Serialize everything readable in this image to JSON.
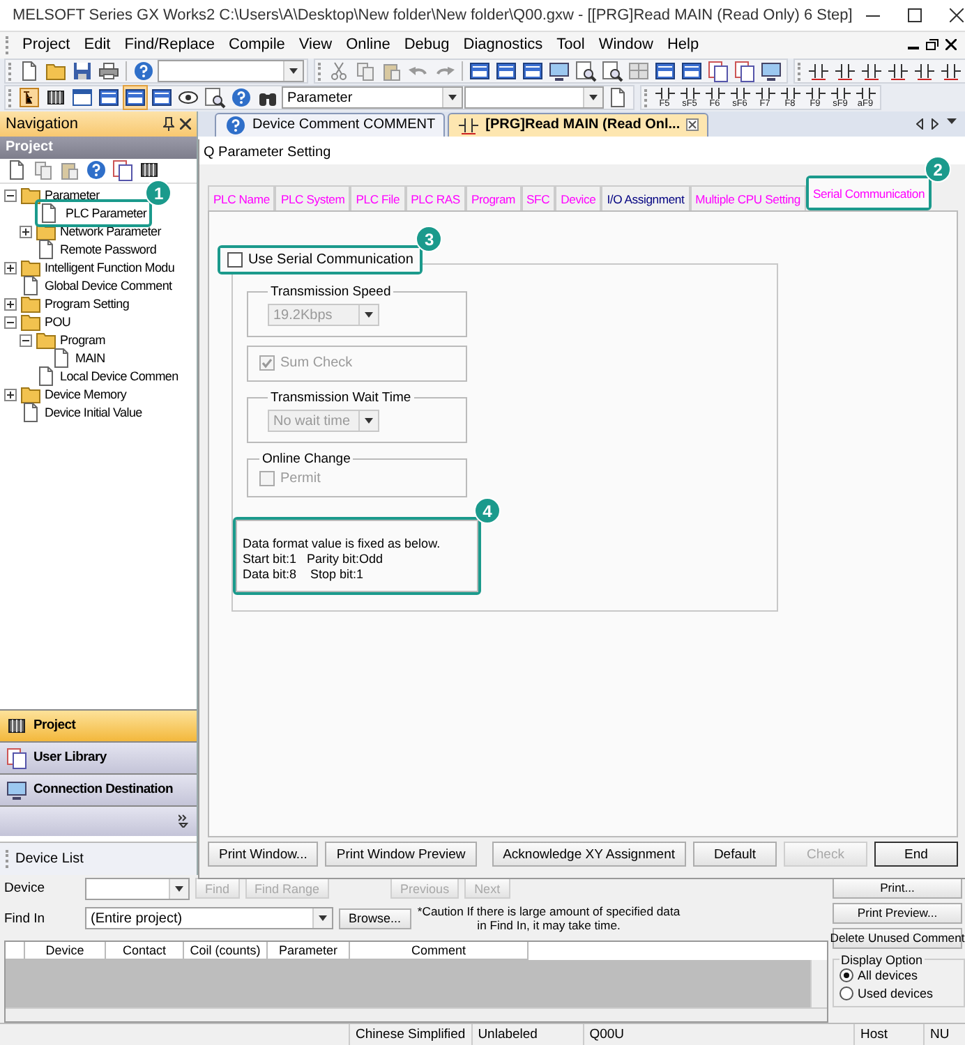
{
  "window": {
    "title": "MELSOFT Series GX Works2 C:\\Users\\A\\Desktop\\New folder\\New folder\\Q00.gxw - [[PRG]Read MAIN (Read Only) 6 Step]"
  },
  "menu": [
    "Project",
    "Edit",
    "Find/Replace",
    "Compile",
    "View",
    "Online",
    "Debug",
    "Diagnostics",
    "Tool",
    "Window",
    "Help"
  ],
  "toolbar": {
    "search_combo": "Parameter",
    "function_keys": [
      "F5",
      "sF5",
      "F6",
      "sF6",
      "F7",
      "F8",
      "F9",
      "sF9",
      "aF9"
    ]
  },
  "navigation": {
    "title": "Navigation",
    "section": "Project",
    "tree": [
      {
        "label": "Parameter",
        "expanded": true,
        "children": [
          {
            "label": "PLC Parameter",
            "callout": "1"
          },
          {
            "label": "Network Parameter",
            "expanded": false
          },
          {
            "label": "Remote Password"
          }
        ]
      },
      {
        "label": "Intelligent Function Modu",
        "expanded": false
      },
      {
        "label": "Global Device Comment"
      },
      {
        "label": "Program Setting",
        "expanded": false
      },
      {
        "label": "POU",
        "expanded": true,
        "children": [
          {
            "label": "Program",
            "expanded": true,
            "children": [
              {
                "label": "MAIN"
              }
            ]
          },
          {
            "label": "Local Device Commen"
          }
        ]
      },
      {
        "label": "Device Memory",
        "expanded": false
      },
      {
        "label": "Device Initial Value"
      }
    ],
    "buttons": [
      {
        "label": "Project",
        "selected": true
      },
      {
        "label": "User Library",
        "selected": false
      },
      {
        "label": "Connection Destination",
        "selected": false
      }
    ]
  },
  "document_tabs": [
    {
      "label": "Device Comment COMMENT",
      "selected": false
    },
    {
      "label": "[PRG]Read MAIN (Read Onl...",
      "selected": true
    }
  ],
  "dialog": {
    "title": "Q Parameter Setting",
    "tabs": [
      {
        "label": "PLC Name",
        "selected": false,
        "color": "#ff00ff"
      },
      {
        "label": "PLC System",
        "selected": false,
        "color": "#ff00ff"
      },
      {
        "label": "PLC File",
        "selected": false,
        "color": "#ff00ff"
      },
      {
        "label": "PLC RAS",
        "selected": false,
        "color": "#ff00ff"
      },
      {
        "label": "Program",
        "selected": false,
        "color": "#ff00ff"
      },
      {
        "label": "SFC",
        "selected": false,
        "color": "#ff00ff"
      },
      {
        "label": "Device",
        "selected": false,
        "color": "#ff00ff"
      },
      {
        "label": "I/O Assignment",
        "selected": false,
        "color": "#000080"
      },
      {
        "label": "Multiple CPU Setting",
        "selected": false,
        "color": "#ff00ff"
      },
      {
        "label": "Serial Communication",
        "selected": true,
        "color": "#ff00ff",
        "callout": "2"
      }
    ],
    "use_serial": {
      "label": "Use Serial Communication",
      "checked": false,
      "callout": "3"
    },
    "groups": [
      {
        "kind": "select",
        "title": "Transmission Speed",
        "value": "19.2Kbps",
        "disabled": true
      },
      {
        "kind": "checkbox",
        "label": "Sum Check",
        "checked": true,
        "disabled": true
      },
      {
        "kind": "select",
        "title": "Transmission Wait Time",
        "value": "No wait time",
        "disabled": true
      },
      {
        "kind": "checkbox",
        "title": "Online Change",
        "label": "Permit",
        "checked": false,
        "disabled": true
      }
    ],
    "info": {
      "lines": [
        "Data format value is fixed as below.",
        "Start bit:1   Parity bit:Odd",
        "Data bit:8    Stop bit:1"
      ],
      "callout": "4"
    },
    "buttons": [
      {
        "label": "Print Window...",
        "disabled": false
      },
      {
        "label": "Print Window Preview",
        "disabled": false
      },
      {
        "label": "Acknowledge XY Assignment",
        "disabled": false
      },
      {
        "label": "Default",
        "disabled": false
      },
      {
        "label": "Check",
        "disabled": true
      },
      {
        "label": "End",
        "disabled": false
      }
    ]
  },
  "device_list": {
    "title": "Device List",
    "device_label": "Device",
    "find_buttons": [
      {
        "label": "Find",
        "disabled": true
      },
      {
        "label": "Find Range",
        "disabled": true
      },
      {
        "label": "Previous",
        "disabled": true
      },
      {
        "label": "Next",
        "disabled": true
      }
    ],
    "find_in_label": "Find In",
    "find_in_value": "(Entire project)",
    "browse": "Browse...",
    "caution": "*Caution If there is large amount of specified data in Find In, it may take time.",
    "columns": [
      "Device",
      "Contact",
      "Coil (counts)",
      "Parameter",
      "Comment"
    ],
    "side_buttons": [
      "Print...",
      "Print Preview...",
      "Delete Unused Comment"
    ],
    "display_option": {
      "title": "Display Option",
      "options": [
        {
          "label": "All devices",
          "selected": true
        },
        {
          "label": "Used devices",
          "selected": false
        }
      ]
    }
  },
  "status_bar": [
    "Chinese Simplified",
    "Unlabeled",
    "Q00U",
    "Host",
    "NU"
  ]
}
